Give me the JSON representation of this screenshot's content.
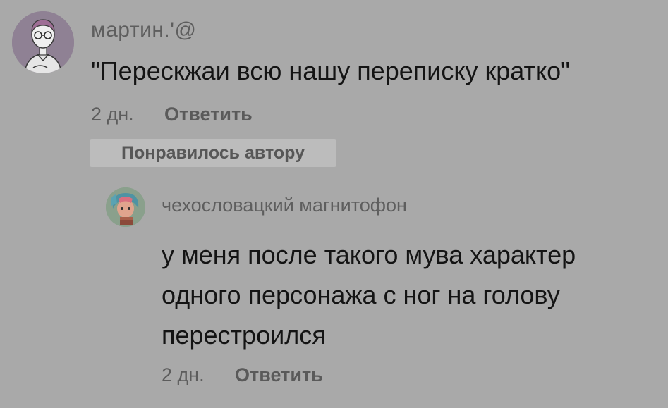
{
  "comment": {
    "username": "мартин.'@",
    "text": "\"Перескжаи всю нашу переписку кратко\"",
    "time": "2 дн.",
    "reply_label": "Ответить",
    "liked_badge": "Понравилось автору",
    "avatar_icon": "cartoon-boy-with-glasses-avatar"
  },
  "reply": {
    "username": "чехословацкий магнитофон",
    "text_lines": [
      "у меня после такого мува характер",
      "одного персонажа с ног на голову",
      "перестроился"
    ],
    "time": "2 дн.",
    "reply_label": "Ответить",
    "avatar_icon": "cartoon-character-avatar"
  }
}
